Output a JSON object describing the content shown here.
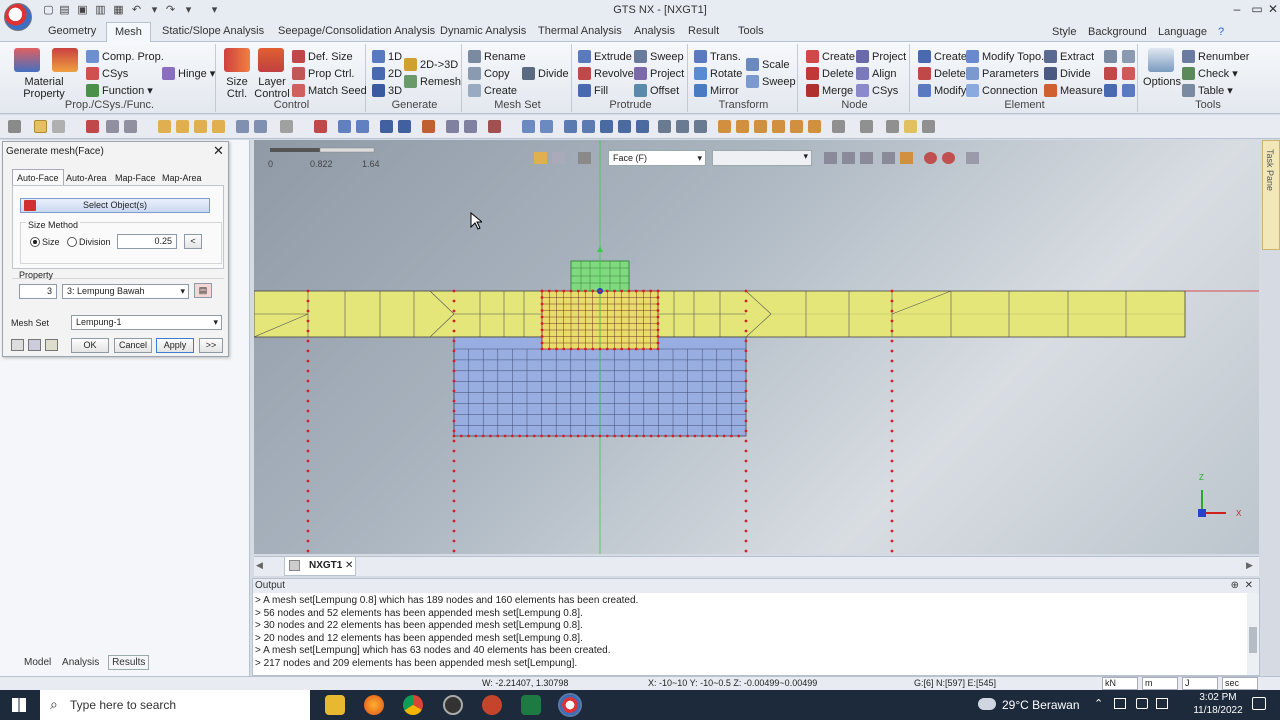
{
  "app": {
    "title": "GTS NX - [NXGT1]"
  },
  "menu": {
    "tabs": [
      "Geometry",
      "Mesh",
      "Static/Slope Analysis",
      "Seepage/Consolidation Analysis",
      "Dynamic Analysis",
      "Thermal Analysis",
      "Analysis",
      "Result",
      "Tools"
    ],
    "active": "Mesh",
    "right": [
      "Style",
      "Background",
      "Language"
    ]
  },
  "ribbon": {
    "groups": [
      {
        "label": "Prop./CSys./Func.",
        "items": [
          "Material Property",
          "Comp. Prop.",
          "CSys",
          "Function",
          "Hinge"
        ]
      },
      {
        "label": "Control",
        "items": [
          "Size Ctrl.",
          "Layer Control",
          "Def. Size",
          "Prop Ctrl.",
          "Match Seed"
        ]
      },
      {
        "label": "Generate",
        "items": [
          "1D",
          "2D",
          "3D",
          "2D->3D",
          "Remesh"
        ]
      },
      {
        "label": "Mesh Set",
        "items": [
          "Rename",
          "Copy",
          "Create",
          "Divide"
        ]
      },
      {
        "label": "Protrude",
        "items": [
          "Extrude",
          "Revolve",
          "Fill",
          "Sweep",
          "Project",
          "Offset"
        ]
      },
      {
        "label": "Transform",
        "items": [
          "Trans.",
          "Rotate",
          "Mirror",
          "Scale",
          "Sweep"
        ]
      },
      {
        "label": "Node",
        "items": [
          "Create",
          "Delete",
          "Merge",
          "Project",
          "Align",
          "CSys"
        ]
      },
      {
        "label": "Element",
        "items": [
          "Create",
          "Delete",
          "Modify",
          "Modify Topo.",
          "Parameters",
          "Connection",
          "Extract",
          "Divide",
          "Measure"
        ]
      },
      {
        "label": "Tools",
        "items": [
          "Options",
          "Renumber",
          "Check",
          "Table"
        ]
      }
    ]
  },
  "dialog": {
    "title": "Generate mesh(Face)",
    "tabs": [
      "Auto-Face",
      "Auto-Area",
      "Map-Face",
      "Map-Area"
    ],
    "select_objects": "Select Object(s)",
    "size_method_label": "Size Method",
    "size_option": "Size",
    "division_option": "Division",
    "size_value": "0.25",
    "back_btn": "<",
    "property_label": "Property",
    "property_id": "3",
    "property_name": "3: Lempung Bawah",
    "mesh_set_label": "Mesh Set",
    "mesh_set_value": "Lempung-1",
    "ok": "OK",
    "cancel": "Cancel",
    "apply": "Apply",
    "more": ">>"
  },
  "left_tabs": [
    "Model",
    "Analysis",
    "Results"
  ],
  "viewport": {
    "scale_labels": [
      "0",
      "0.822",
      "1.64"
    ],
    "filter_value": "Face (F)",
    "axis_z": "Z",
    "axis_x": "X"
  },
  "doc_tab": "NXGT1",
  "output": {
    "title": "Output",
    "lines": [
      "> A mesh set[Lempung 0.8] which has 189 nodes and 160 elements has been created.",
      "> 56 nodes and 52 elements has been appended mesh set[Lempung 0.8].",
      "> 30 nodes and 22 elements has been appended mesh set[Lempung 0.8].",
      "> 20 nodes and 12 elements has been appended mesh set[Lempung 0.8].",
      "> A mesh set[Lempung] which has 63 nodes and 40 elements has been created.",
      "> 217 nodes and 209 elements has been appended mesh set[Lempung]."
    ]
  },
  "status": {
    "coords": "W: -2.21407, 1.30798",
    "range": "X: -10~10 Y: -10~0.5 Z: -0.00499~0.00499",
    "counts": "G:[6] N:[597] E:[545]",
    "unit_force": "kN",
    "unit_length": "m",
    "unit_energy": "J",
    "unit_time": "sec"
  },
  "taskbar": {
    "search": "Type here to search",
    "weather": "29°C Berawan",
    "time": "3:02 PM",
    "date": "11/18/2022"
  },
  "task_pane": "Task Pane",
  "colors": {
    "soil_yellow": "#e4e67a",
    "soil_blue": "#98aee0",
    "foundation_green": "#7fd97f",
    "node_red": "#d81e2a"
  }
}
